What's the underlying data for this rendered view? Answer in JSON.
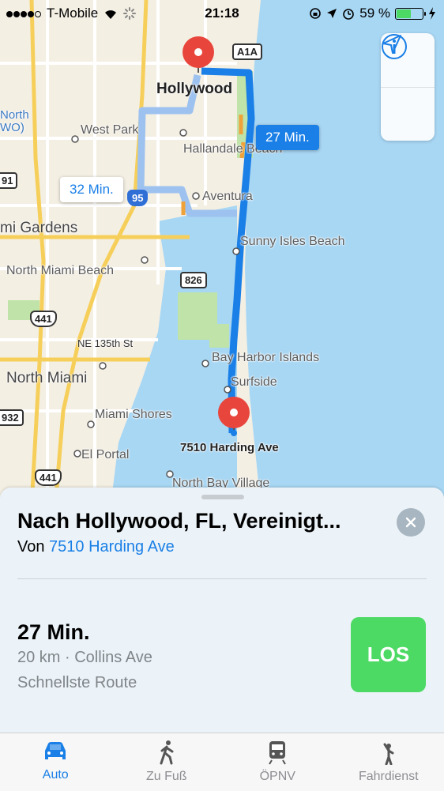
{
  "status_bar": {
    "carrier": "T-Mobile",
    "time": "21:18",
    "battery_percent": "59 %",
    "battery_level": 0.59
  },
  "map": {
    "places": [
      "Hollywood",
      "West Park",
      "Hallandale Beach",
      "Aventura",
      "Sunny Isles Beach",
      "mi Gardens",
      "North Miami Beach",
      "NE 135th St",
      "North Miami",
      "Bay Harbor Islands",
      "Surfside",
      "Miami Shores",
      "El Portal",
      "North Bay Village",
      "North",
      "WO)"
    ],
    "destination_pin_label": "Hollywood",
    "origin_pin_label": "7510 Harding Ave",
    "shields": [
      "A1A",
      "95",
      "826",
      "441",
      "91",
      "932",
      "441"
    ],
    "route_bubbles": {
      "primary": "27 Min.",
      "alternative": "32 Min."
    },
    "controls": {
      "info_icon": "info-icon",
      "location_icon": "location-arrow-icon"
    },
    "colors": {
      "route_primary": "#1a7fe6",
      "route_alt": "#9ec2ef",
      "water": "#a8d7f4",
      "land": "#f4efe3",
      "pin": "#e8463c"
    }
  },
  "card": {
    "title": "Nach Hollywood, FL, Vereinigt...",
    "from_prefix": "Von",
    "from_link": "7510 Harding Ave",
    "eta": "27 Min.",
    "details": "20 km · Collins Ave",
    "route_type": "Schnellste Route",
    "go_label": "LOS"
  },
  "tabs": [
    {
      "label": "Auto",
      "icon": "car-icon",
      "active": true
    },
    {
      "label": "Zu Fuß",
      "icon": "walking-icon",
      "active": false
    },
    {
      "label": "ÖPNV",
      "icon": "train-icon",
      "active": false
    },
    {
      "label": "Fahrdienst",
      "icon": "ride-hail-icon",
      "active": false
    }
  ]
}
